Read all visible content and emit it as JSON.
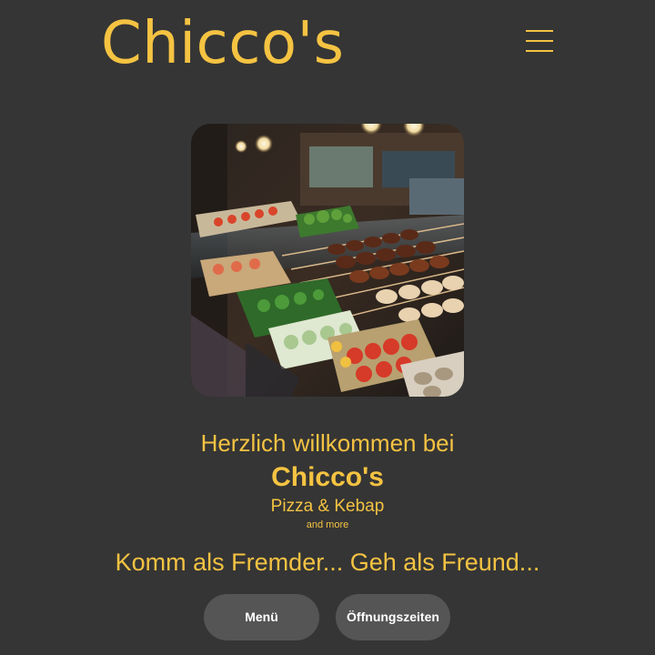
{
  "header": {
    "logo_text": "Chicco's",
    "menu_icon": "hamburger-menu-icon"
  },
  "hero": {
    "image_subject": "kebab skewers and salads in food display counter"
  },
  "welcome": {
    "line1": "Herzlich willkommen bei",
    "brand": "Chicco's",
    "subtitle": "Pizza & Kebap",
    "small": "and more",
    "slogan": "Komm als Fremder... Geh als Freund..."
  },
  "buttons": {
    "menu_label": "Menü",
    "hours_label": "Öffnungszeiten"
  },
  "colors": {
    "background": "#353535",
    "accent": "#f5c342",
    "button_bg": "#555555",
    "button_text": "#ffffff"
  }
}
